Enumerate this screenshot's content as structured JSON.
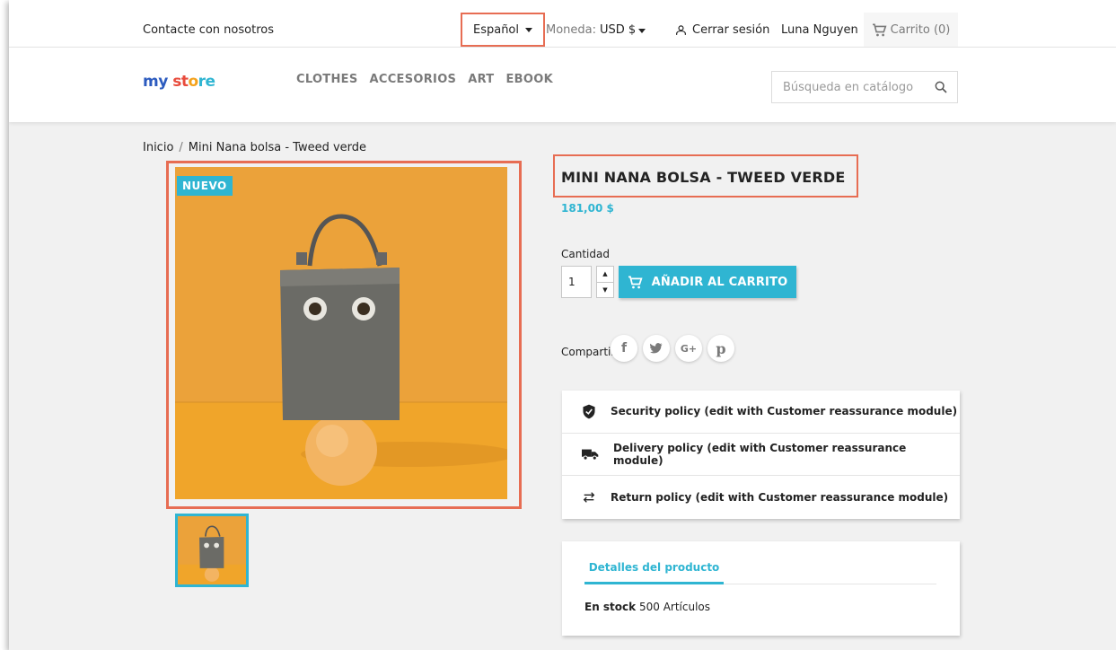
{
  "topbar": {
    "contact": "Contacte con nosotros",
    "language": "Español",
    "currency_label": "Moneda:",
    "currency_value": "USD $",
    "logout": "Cerrar sesión",
    "username": "Luna Nguyen",
    "cart": "Carrito (0)"
  },
  "header": {
    "logo_part1": "my",
    "logo_part2": "st",
    "logo_part3": "o",
    "logo_part4": "re",
    "nav": [
      "CLOTHES",
      "ACCESORIOS",
      "ART",
      "EBOOK"
    ],
    "search_placeholder": "Búsqueda en catálogo"
  },
  "breadcrumb": {
    "home": "Inicio",
    "separator": "/",
    "current": "Mini Nana bolsa - Tweed verde"
  },
  "product": {
    "badge": "NUEVO",
    "title": "MINI NANA BOLSA - TWEED VERDE",
    "price": "181,00 $",
    "quantity_label": "Cantidad",
    "quantity_value": "1",
    "add_to_cart": "AÑADIR AL CARRITO",
    "share_label": "Compartir",
    "share_icons": [
      "facebook-icon",
      "twitter-icon",
      "google-plus-icon",
      "pinterest-icon"
    ]
  },
  "reassurance": [
    {
      "icon": "shield-icon",
      "text": "Security policy (edit with Customer reassurance module)"
    },
    {
      "icon": "truck-icon",
      "text": "Delivery policy (edit with Customer reassurance module)"
    },
    {
      "icon": "swap-arrows-icon",
      "text": "Return policy (edit with Customer reassurance module)"
    }
  ],
  "details": {
    "tab": "Detalles del producto",
    "stock_label": "En stock",
    "stock_value": "500 Artículos"
  },
  "colors": {
    "accent": "#2fb5d2",
    "highlight": "#e76d53",
    "image_bg": "#e9a13c"
  }
}
